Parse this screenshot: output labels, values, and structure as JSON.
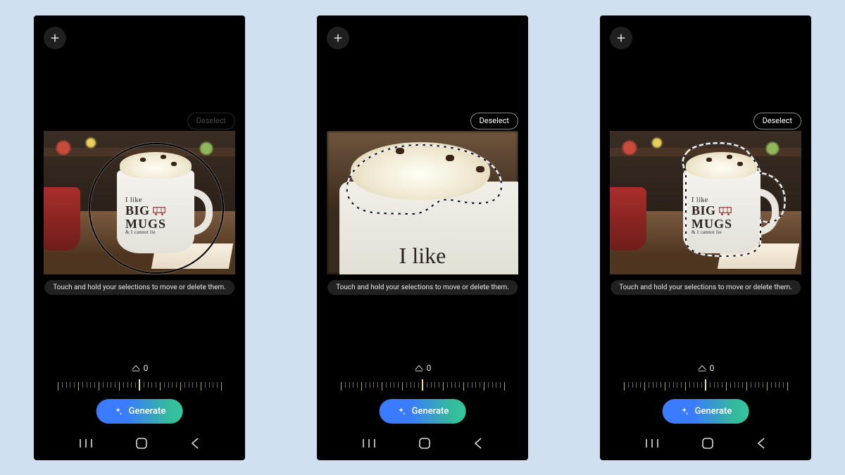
{
  "hint_text": "Touch and hold your selections to move or delete them.",
  "deselect_label": "Deselect",
  "generate_label": "Generate",
  "rotation_value": "0",
  "mug_text": {
    "line1": "I like",
    "line2": "BIG",
    "line3": "MUGS",
    "line4": "& I cannot lie"
  },
  "zoomed_text": "I like",
  "screens": [
    {
      "deselect_dim": true,
      "view": "wide",
      "selection": "loose"
    },
    {
      "deselect_dim": false,
      "view": "zoom",
      "selection": "cream"
    },
    {
      "deselect_dim": false,
      "view": "wide",
      "selection": "tight"
    }
  ]
}
